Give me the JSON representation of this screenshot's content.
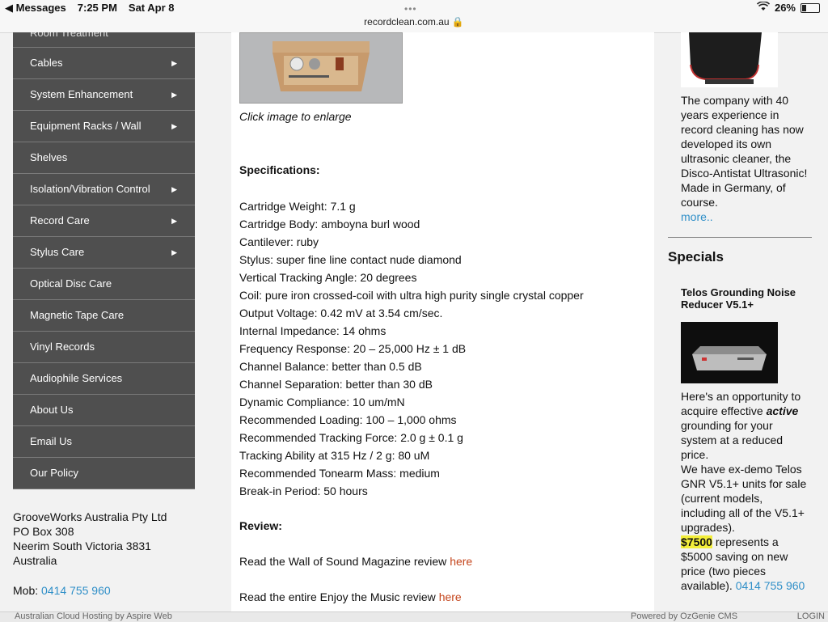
{
  "status": {
    "back_label": "◀ Messages",
    "time": "7:25 PM",
    "date": "Sat Apr 8",
    "battery": "26%"
  },
  "browser": {
    "url": "recordclean.com.au"
  },
  "sidebar": {
    "partial_top": "Room Treatment",
    "items": [
      {
        "label": "Cables",
        "submenu": true
      },
      {
        "label": "System Enhancement",
        "submenu": true
      },
      {
        "label": "Equipment Racks / Wall",
        "submenu": true
      },
      {
        "label": "Shelves",
        "submenu": false
      },
      {
        "label": "Isolation/Vibration Control",
        "submenu": true
      },
      {
        "label": "Record Care",
        "submenu": true
      },
      {
        "label": "Stylus Care",
        "submenu": true
      },
      {
        "label": "Optical Disc Care",
        "submenu": false
      },
      {
        "label": "Magnetic Tape Care",
        "submenu": false
      },
      {
        "label": "Vinyl Records",
        "submenu": false
      },
      {
        "label": "Audiophile Services",
        "submenu": false
      },
      {
        "label": "About Us",
        "submenu": false
      },
      {
        "label": "Email Us",
        "submenu": false
      },
      {
        "label": "Our Policy",
        "submenu": false
      }
    ]
  },
  "contact": {
    "lines": [
      "GrooveWorks Australia Pty Ltd",
      "PO Box 308",
      "Neerim South Victoria 3831",
      "Australia"
    ],
    "mob_label": "Mob: ",
    "mob": "0414 755 960"
  },
  "main": {
    "caption": "Click image to enlarge",
    "spec_title": "Specifications:",
    "specs": [
      "Cartridge Weight: 7.1 g",
      "Cartridge Body: amboyna burl wood",
      "Cantilever: ruby",
      "Stylus: super fine line contact nude diamond",
      "Vertical Tracking Angle: 20 degrees",
      "Coil: pure iron crossed-coil with ultra high purity single crystal copper",
      "Output Voltage: 0.42 mV at 3.54 cm/sec.",
      "Internal Impedance: 14 ohms",
      "Frequency Response: 20 – 25,000 Hz ± 1 dB",
      "Channel Balance: better than 0.5 dB",
      "Channel Separation: better than 30 dB",
      "Dynamic Compliance: 10 um/mN",
      "Recommended Loading: 100 – 1,000 ohms",
      "Recommended Tracking Force: 2.0 g ± 0.1 g",
      "Tracking Ability at 315 Hz / 2 g: 80 uM",
      "Recommended Tonearm Mass: medium",
      "Break-in Period: 50 hours"
    ],
    "review_title": "Review:",
    "review1_text": "Read the Wall of Sound Magazine review ",
    "review2_text": "Read the entire Enjoy the Music review ",
    "here": "here"
  },
  "right": {
    "blurb": "The company with 40 years experience in record cleaning has now developed its own ultrasonic cleaner, the Disco-Antistat Ultrasonic!",
    "blurb2": "Made in Germany, of course.",
    "more": "more..",
    "specials_heading": "Specials",
    "special_title": "Telos Grounding Noise Reducer V5.1+",
    "special_p1a": "Here's an opportunity to acquire effective ",
    "special_p1b": "active",
    "special_p1c": " grounding for your system at a reduced price.",
    "special_p2": "We have ex-demo Telos GNR V5.1+ units for sale (current models, including all of the V5.1+ upgrades).",
    "price": "$7500",
    "special_p3": " represents a $5000 saving on new price (two pieces available). ",
    "phone": "0414 755 960"
  },
  "footer": {
    "left": "Australian Cloud Hosting by Aspire Web",
    "middle": "Powered by OzGenie CMS",
    "right": "LOGIN"
  }
}
